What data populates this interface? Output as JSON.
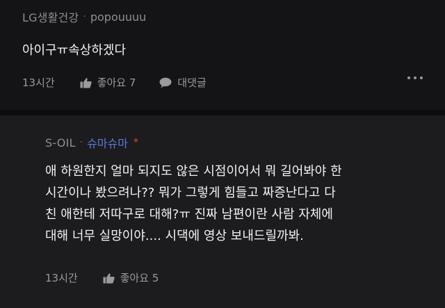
{
  "comments": [
    {
      "author": "LG생활건강",
      "nickname": "popouuuu",
      "body": "아이구ㅠ속상하겠다",
      "time": "13시간",
      "like_label": "좋아요 7",
      "reply_label": "대댓글"
    },
    {
      "author": "S-OIL",
      "nickname": "슈마슈마",
      "badge": "*",
      "body": "애 하원한지 얼마 되지도 않은 시점이어서 뭐 길어봐야 한\n시간이나 봤으려나?? 뭐가 그렇게 힘들고 짜증난다고 다\n친 애한테 저따구로 대해?ㅠ 진짜 남편이란 사람 자체에\n대해 너무 실망이야.... 시댁에 영상 보내드릴까봐.",
      "time": "13시간",
      "like_label": "좋아요 5"
    }
  ],
  "colors": {
    "background": "#141416",
    "reply_background": "#1c1c1e",
    "nickname_accent": "#5f78d8",
    "badge": "#e0453a"
  },
  "icons": {
    "like": "thumbs-up-icon",
    "reply": "speech-bubble-icon",
    "more": "more-horizontal-icon"
  }
}
